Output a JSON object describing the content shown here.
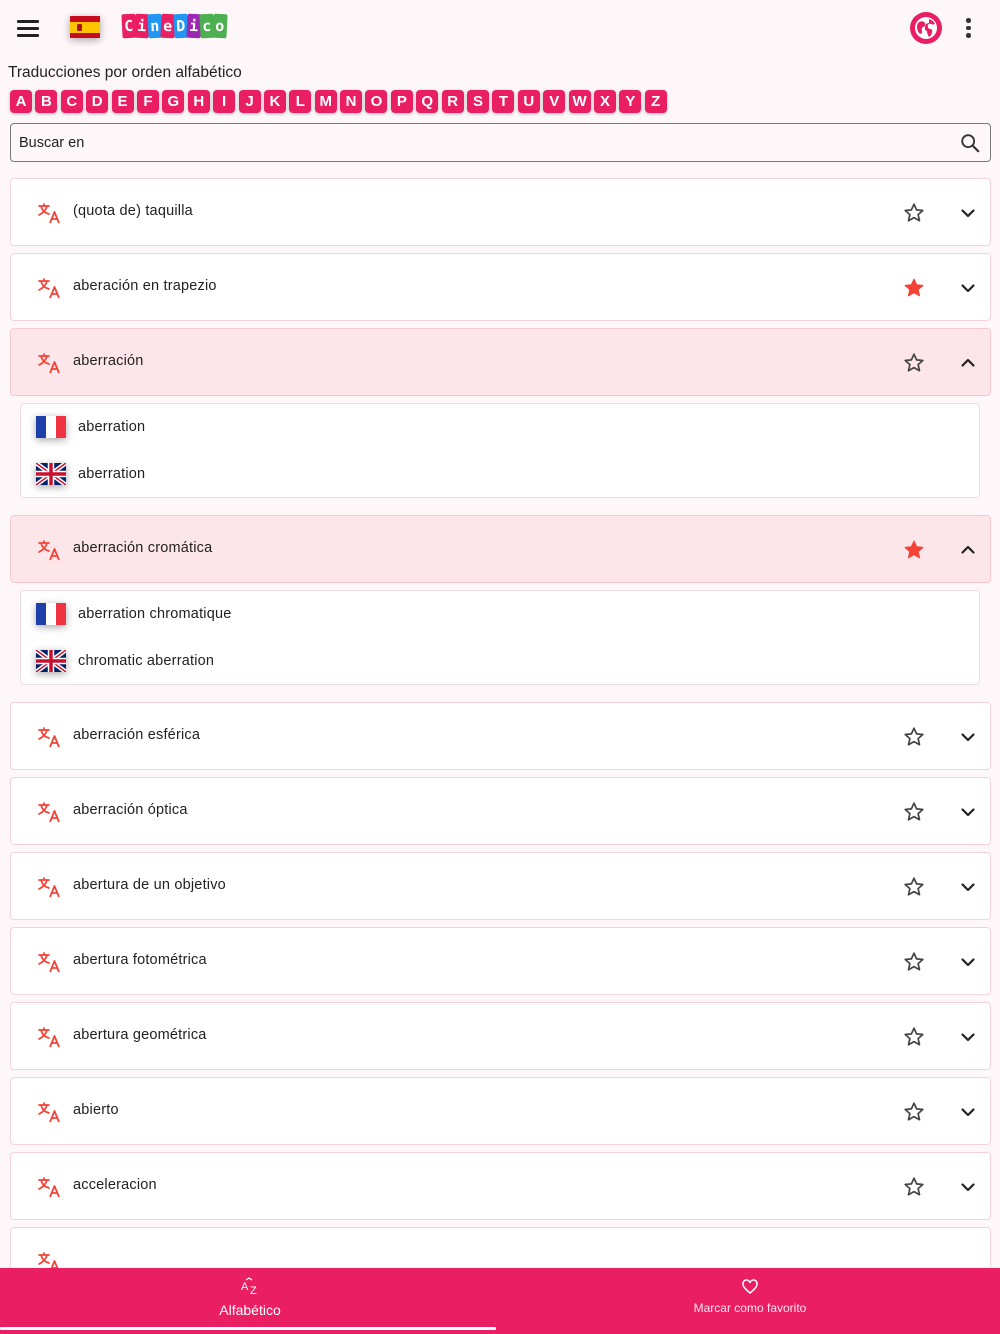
{
  "app": {
    "logo_letters": [
      "C",
      "i",
      "n",
      "e",
      "D",
      "i",
      "c",
      "o"
    ],
    "logo_colors": [
      "#e91e63",
      "#e91e63",
      "#2196f3",
      "#e91e63",
      "#2196f3",
      "#9c27b0",
      "#4caf50",
      "#4caf50"
    ]
  },
  "heading": "Traducciones por orden alfabético",
  "letters": [
    "A",
    "B",
    "C",
    "D",
    "E",
    "F",
    "G",
    "H",
    "I",
    "J",
    "K",
    "L",
    "M",
    "N",
    "O",
    "P",
    "Q",
    "R",
    "S",
    "T",
    "U",
    "V",
    "W",
    "X",
    "Y",
    "Z"
  ],
  "search": {
    "placeholder": "Buscar en"
  },
  "items": [
    {
      "term": "(quota de) taquilla",
      "favorite": false,
      "expanded": false
    },
    {
      "term": "aberación en trapezio",
      "favorite": true,
      "expanded": false
    },
    {
      "term": "aberración",
      "favorite": false,
      "expanded": true,
      "translations": [
        {
          "lang": "fr",
          "text": "aberration"
        },
        {
          "lang": "en",
          "text": "aberration"
        }
      ]
    },
    {
      "term": "aberración cromática",
      "favorite": true,
      "expanded": true,
      "translations": [
        {
          "lang": "fr",
          "text": "aberration chromatique"
        },
        {
          "lang": "en",
          "text": "chromatic aberration"
        }
      ]
    },
    {
      "term": "aberración esférica",
      "favorite": false,
      "expanded": false
    },
    {
      "term": "aberración óptica",
      "favorite": false,
      "expanded": false
    },
    {
      "term": "abertura de un objetivo",
      "favorite": false,
      "expanded": false
    },
    {
      "term": "abertura fotométrica",
      "favorite": false,
      "expanded": false
    },
    {
      "term": "abertura geométrica",
      "favorite": false,
      "expanded": false
    },
    {
      "term": "abierto",
      "favorite": false,
      "expanded": false
    },
    {
      "term": "acceleracion",
      "favorite": false,
      "expanded": false
    }
  ],
  "bottom_nav": {
    "alphabetic_label": "Alfabético",
    "favorite_label": "Marcar como favorito"
  },
  "colors": {
    "accent": "#e91e63",
    "star_filled": "#f44336",
    "expanded_bg": "#fde6e9"
  },
  "icons": {
    "menu": "menu-icon",
    "globe": "globe-icon",
    "more": "more-vert-icon",
    "search": "search-icon",
    "translate": "translate-icon",
    "star": "star-icon",
    "chevron": "chevron-icon",
    "sort_az": "sort-az-icon",
    "heart": "heart-icon"
  }
}
